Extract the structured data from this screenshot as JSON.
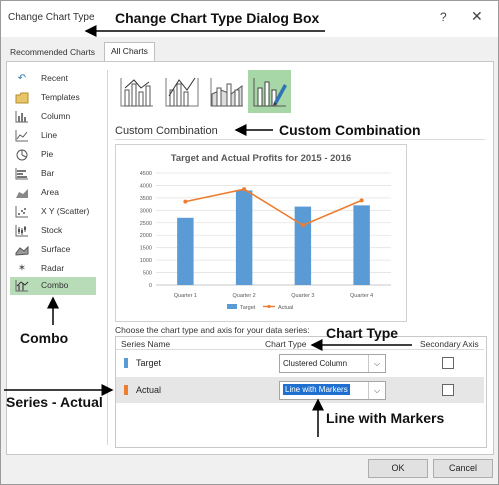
{
  "dialog": {
    "title": "Change Chart Type",
    "help_glyph": "?",
    "close_glyph": "✕",
    "tabs": [
      {
        "label": "Recommended Charts",
        "active": false
      },
      {
        "label": "All Charts",
        "active": true
      }
    ]
  },
  "sidebar": {
    "items": [
      {
        "label": "Recent",
        "icon": "recent-icon"
      },
      {
        "label": "Templates",
        "icon": "templates-icon"
      },
      {
        "label": "Column",
        "icon": "column-chart-icon"
      },
      {
        "label": "Line",
        "icon": "line-chart-icon"
      },
      {
        "label": "Pie",
        "icon": "pie-chart-icon"
      },
      {
        "label": "Bar",
        "icon": "bar-chart-icon"
      },
      {
        "label": "Area",
        "icon": "area-chart-icon"
      },
      {
        "label": "X Y (Scatter)",
        "icon": "scatter-chart-icon"
      },
      {
        "label": "Stock",
        "icon": "stock-chart-icon"
      },
      {
        "label": "Surface",
        "icon": "surface-chart-icon"
      },
      {
        "label": "Radar",
        "icon": "radar-chart-icon"
      },
      {
        "label": "Combo",
        "icon": "combo-chart-icon",
        "selected": true
      }
    ]
  },
  "subtypes": [
    {
      "icon": "clustered-column-line-icon",
      "selected": false
    },
    {
      "icon": "clustered-column-line-secondary-axis-icon",
      "selected": false
    },
    {
      "icon": "stacked-area-clustered-column-icon",
      "selected": false
    },
    {
      "icon": "custom-combination-icon",
      "selected": true
    }
  ],
  "main": {
    "heading": "Custom Combination",
    "choose_text": "Choose the chart type and axis for your data series:"
  },
  "chart_data": {
    "type": "bar",
    "title": "Target and Actual Profits for 2015 - 2016",
    "categories": [
      "Quarter 1",
      "Quarter 2",
      "Quarter 3",
      "Quarter 4"
    ],
    "series": [
      {
        "name": "Target",
        "type": "bar",
        "color": "#5b9bd5",
        "values": [
          2700,
          3800,
          3150,
          3200
        ]
      },
      {
        "name": "Actual",
        "type": "line",
        "color": "#ed7d31",
        "values": [
          3350,
          3850,
          2400,
          3400
        ]
      }
    ],
    "ylim": [
      0,
      4500
    ],
    "yticks": [
      "0",
      "500",
      "1000",
      "1500",
      "2000",
      "2500",
      "3000",
      "3500",
      "4000",
      "4500"
    ],
    "grid": true,
    "legend": "bottom"
  },
  "series_table": {
    "headers": {
      "name": "Series Name",
      "type": "Chart Type",
      "axis": "Secondary Axis"
    },
    "rows": [
      {
        "name": "Target",
        "color": "#5b9bd5",
        "chart_type": "Clustered Column",
        "secondary": false
      },
      {
        "name": "Actual",
        "color": "#ed7d31",
        "chart_type": "Line with Markers",
        "secondary": false
      }
    ]
  },
  "buttons": {
    "ok": "OK",
    "cancel": "Cancel"
  },
  "annotations": {
    "title": "Change Chart Type Dialog Box",
    "custom": "Custom Combination",
    "combo": "Combo",
    "chart_type": "Chart Type",
    "series": "Series - Actual",
    "line_markers": "Line with Markers"
  }
}
